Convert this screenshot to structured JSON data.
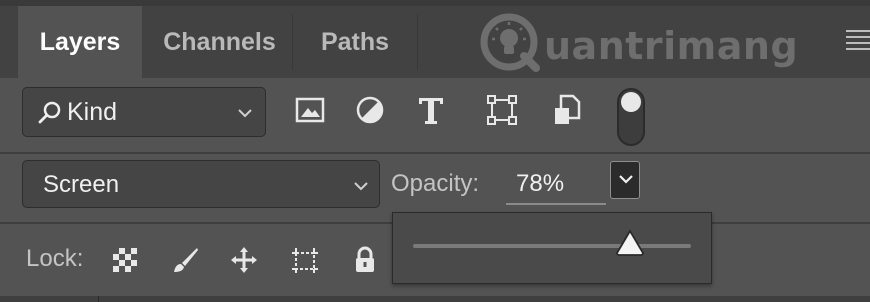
{
  "tabs": [
    {
      "label": "Layers",
      "active": true
    },
    {
      "label": "Channels",
      "active": false
    },
    {
      "label": "Paths",
      "active": false
    }
  ],
  "watermark": {
    "text": "uantrimang",
    "letter": "Q"
  },
  "filter": {
    "kind_label": "Kind",
    "icons": [
      "image-filter-icon",
      "adjustment-filter-icon",
      "type-filter-icon",
      "shape-filter-icon",
      "smart-object-filter-icon"
    ],
    "toggle_on": true
  },
  "blend_mode": {
    "value": "Screen"
  },
  "opacity": {
    "label": "Opacity:",
    "value": "78%",
    "slider_value": 78
  },
  "lock": {
    "label": "Lock:",
    "icons": [
      "lock-transparent-pixels-icon",
      "lock-image-pixels-icon",
      "lock-position-icon",
      "lock-artboard-icon",
      "lock-all-icon"
    ]
  },
  "colors": {
    "panel": "#535353",
    "tabbar": "#424242",
    "text_active": "#ffffff",
    "text_dim": "#b9b9b9"
  }
}
